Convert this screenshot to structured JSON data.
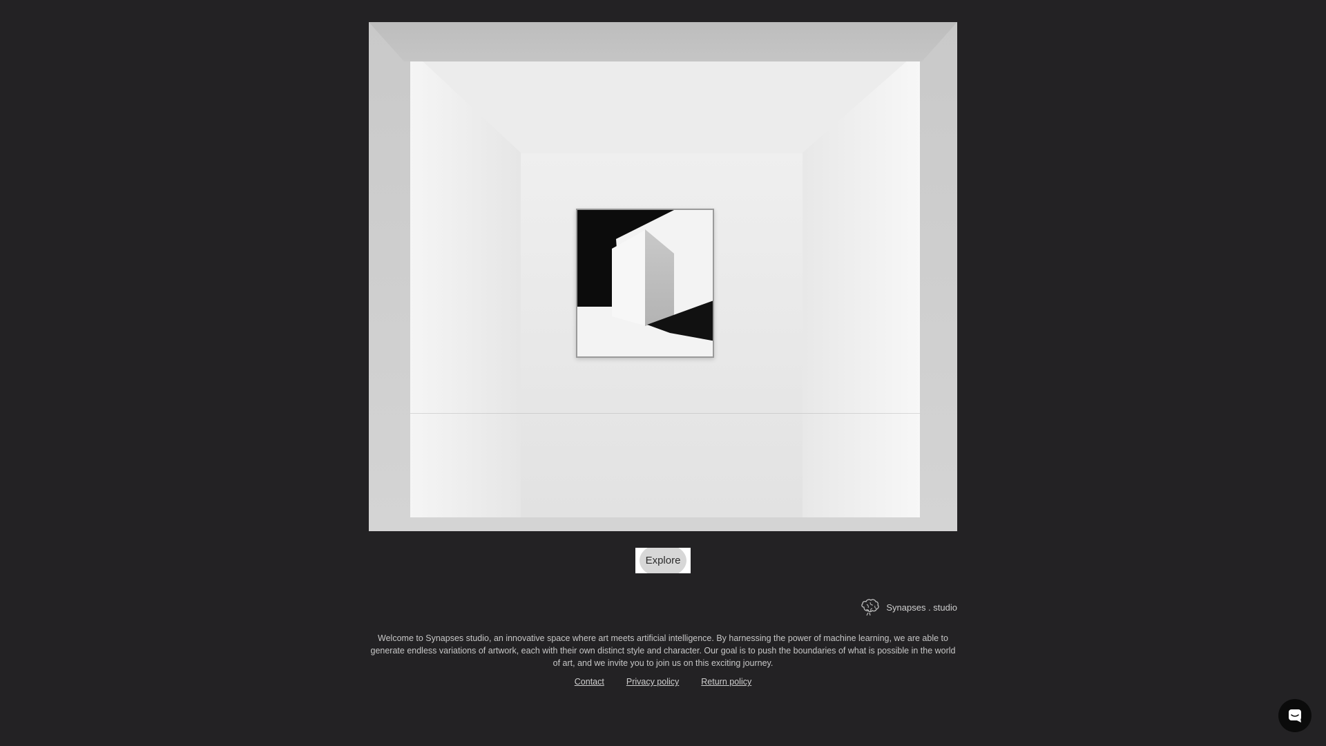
{
  "hero": {
    "alt": "Gallery room with framed abstract artwork"
  },
  "explore": {
    "label": "Explore"
  },
  "brand": {
    "name": "Synapses . studio",
    "logo_icon": "brain-icon"
  },
  "description": {
    "text": "Welcome to Synapses studio, an innovative space where art meets artificial intelligence. By harnessing the power of machine learning, we are able to generate endless variations of artwork, each with their own distinct style and character. Our goal is to push the boundaries of what is possible in the world of art, and we invite you to join us on this exciting journey."
  },
  "footer": {
    "links": [
      {
        "label": "Contact"
      },
      {
        "label": "Privacy policy"
      },
      {
        "label": "Return policy"
      }
    ]
  },
  "chat": {
    "icon": "chat-icon"
  },
  "colors": {
    "background": "#232224",
    "button_bg": "#ffffff",
    "text_muted": "#c7c7c7"
  }
}
